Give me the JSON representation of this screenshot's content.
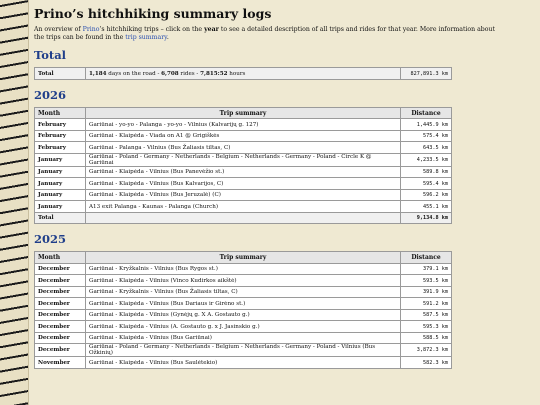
{
  "page": {
    "title": "Prino’s hitchhiking summary logs",
    "intro": {
      "part1": "An overview of ",
      "link_prino": "Prino",
      "part2": "’s hitchhiking trips – click on the ",
      "bold_year": "year",
      "part3": " to see a detailed description of all trips and rides for that year. More information about the trips can be found in the ",
      "link_trip_summary": "trip summary",
      "part4": "."
    }
  },
  "total": {
    "heading": "Total",
    "label": "Total",
    "days": "1,184",
    "days_text": " days on the road - ",
    "rides": "6,708",
    "rides_text": " rides - ",
    "hours": "7,815:52",
    "hours_text": " hours",
    "distance": "827,891.3 km"
  },
  "tables": [
    {
      "year": "2026",
      "headers": {
        "month": "Month",
        "trip": "Trip summary",
        "distance": "Distance"
      },
      "rows": [
        {
          "month": "February",
          "trip": "Gariūnai - yo-yo - Palanga - yo-yo - Vilnius (Kalvarijų g. 127)",
          "distance": "1,445.9 km"
        },
        {
          "month": "February",
          "trip": "Gariūnai - Klaipėda - Viada on A1 @ Grigiškės",
          "distance": "575.4 km"
        },
        {
          "month": "February",
          "trip": "Gariūnai - Palanga - Vilnius (Bus Žaliasis tiltas, C)",
          "distance": "643.5 km"
        },
        {
          "month": "January",
          "trip": "Gariūnai - Poland - Germany - Netherlands - Belgium - Netherlands - Germany - Poland - Circle K @ Gariūnai",
          "distance": "4,233.5 km"
        },
        {
          "month": "January",
          "trip": "Gariūnai - Klaipėda - Vilnius (Bus Panevėžio st.)",
          "distance": "589.8 km"
        },
        {
          "month": "January",
          "trip": "Gariūnai - Klaipėda - Vilnius (Bus Kalvarijos, C)",
          "distance": "595.4 km"
        },
        {
          "month": "January",
          "trip": "Gariūnai - Klaipėda - Vilnius (Bus Jeruzalė) (C)",
          "distance": "596.2 km"
        },
        {
          "month": "January",
          "trip": "A13 exit Palanga - Kaunas - Palanga (Church)",
          "distance": "455.1 km"
        }
      ],
      "total_label": "Total",
      "total_distance": "9,134.8 km"
    },
    {
      "year": "2025",
      "headers": {
        "month": "Month",
        "trip": "Trip summary",
        "distance": "Distance"
      },
      "rows": [
        {
          "month": "December",
          "trip": "Gariūnai - Kryžkalnis - Vilnius (Bus Rygos st.)",
          "distance": "379.1 km"
        },
        {
          "month": "December",
          "trip": "Gariūnai - Klaipėda - Vilnius (Vinco Kudirkos aikštė)",
          "distance": "593.5 km"
        },
        {
          "month": "December",
          "trip": "Gariūnai - Kryžkalnis - Vilnius (Bus Žaliasis tiltas, C)",
          "distance": "391.9 km"
        },
        {
          "month": "December",
          "trip": "Gariūnai - Klaipėda - Vilnius (Bus Dariaus ir Girėno st.)",
          "distance": "591.2 km"
        },
        {
          "month": "December",
          "trip": "Gariūnai - Klaipėda - Vilnius (Gynėjų g. X A. Gostauto g.)",
          "distance": "587.5 km"
        },
        {
          "month": "December",
          "trip": "Gariūnai - Klaipėda - Vilnius (A. Gostauto g. x J. Jasinskio g.)",
          "distance": "595.3 km"
        },
        {
          "month": "December",
          "trip": "Gariūnai - Klaipėda - Vilnius (Bus Gariūnai)",
          "distance": "588.5 km"
        },
        {
          "month": "December",
          "trip": "Gariūnai - Poland - Germany - Netherlands - Belgium - Netherlands - Germany - Poland - Vilnius (Bus Ožkinių)",
          "distance": "3,872.3 km"
        },
        {
          "month": "November",
          "trip": "Gariūnai - Klaipėda - Vilnius (Bus Saulėtekio)",
          "distance": "582.3 km"
        }
      ]
    }
  ]
}
